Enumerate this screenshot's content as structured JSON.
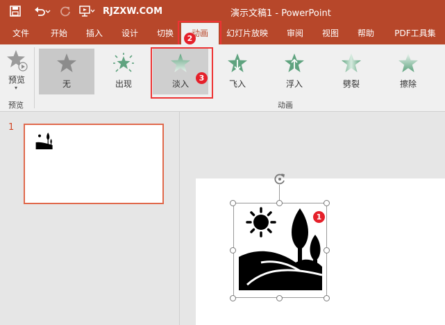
{
  "site_watermark": "RJZXW.COM",
  "window_title": "演示文稿1  -  PowerPoint",
  "tabs": [
    {
      "label": "文件"
    },
    {
      "label": "开始"
    },
    {
      "label": "插入"
    },
    {
      "label": "设计"
    },
    {
      "label": "切换"
    },
    {
      "label": "动画"
    },
    {
      "label": "幻灯片放映"
    },
    {
      "label": "审阅"
    },
    {
      "label": "视图"
    },
    {
      "label": "帮助"
    },
    {
      "label": "PDF工具集"
    }
  ],
  "active_tab": "动画",
  "preview": {
    "label": "预览",
    "group_label": "预览"
  },
  "animations": [
    {
      "label": "无",
      "icon": "star-none-icon"
    },
    {
      "label": "出现",
      "icon": "star-appear-icon"
    },
    {
      "label": "淡入",
      "icon": "star-fade-icon"
    },
    {
      "label": "飞入",
      "icon": "star-fly-in-icon"
    },
    {
      "label": "浮入",
      "icon": "star-float-in-icon"
    },
    {
      "label": "劈裂",
      "icon": "star-split-icon"
    },
    {
      "label": "擦除",
      "icon": "star-wipe-icon"
    }
  ],
  "animation_group_label": "动画",
  "slide_number": "1",
  "badges": {
    "one": "1",
    "two": "2",
    "three": "3"
  },
  "colors": {
    "accent": "#b7472a",
    "highlight": "#e5202a",
    "star_gray": "#8c8c8c",
    "star_green": "#5fa37f"
  }
}
